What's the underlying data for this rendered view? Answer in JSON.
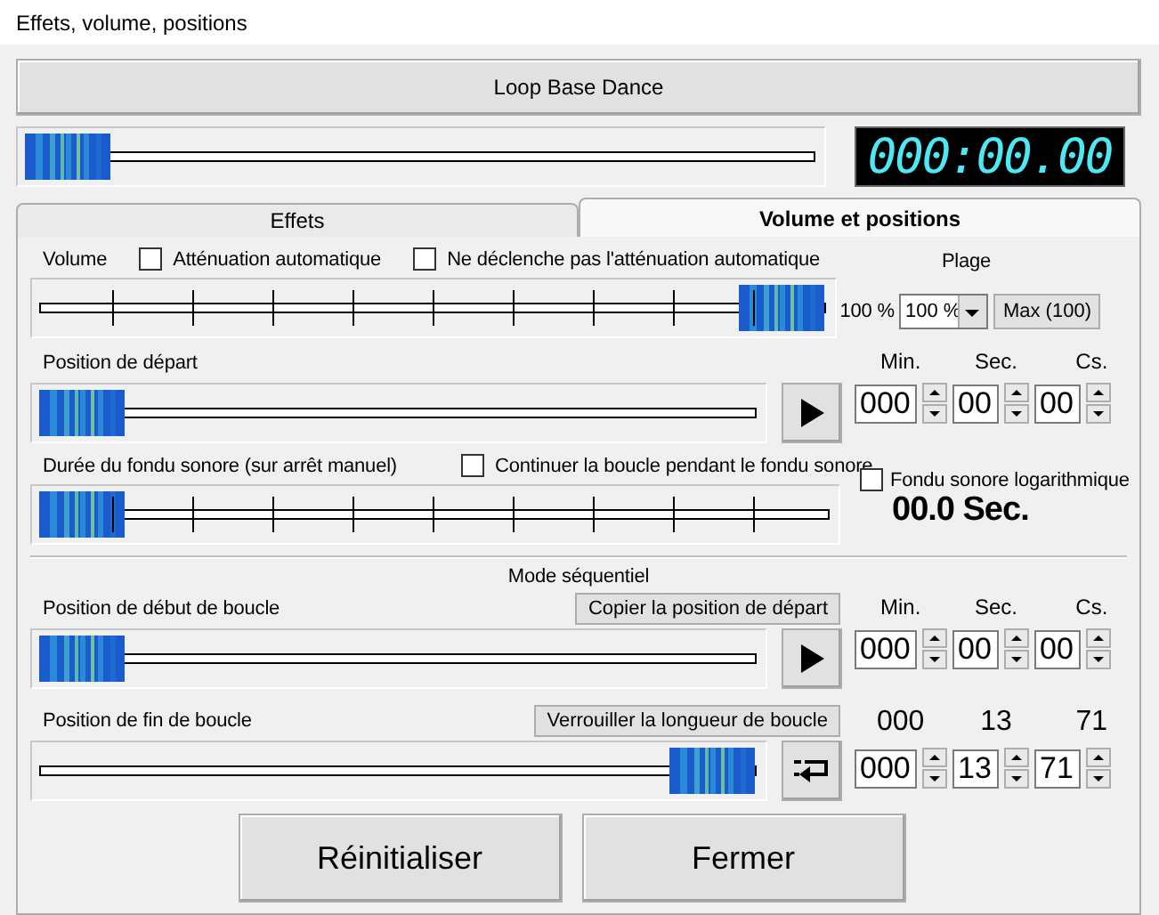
{
  "window": {
    "title": "Effets, volume, positions"
  },
  "track_button": "Loop Base Dance",
  "playback": {
    "level": 0,
    "time_display": "000:00.00"
  },
  "tabs": [
    {
      "label": "Effets",
      "selected": false
    },
    {
      "label": "Volume et positions",
      "selected": true
    }
  ],
  "volume": {
    "label": "Volume",
    "checkboxes": [
      {
        "label": "Atténuation automatique",
        "checked": false
      },
      {
        "label": "Ne déclenche pas l'atténuation automatique",
        "checked": false
      }
    ],
    "level": 1,
    "reading": "100 %",
    "range": {
      "label": "Plage",
      "value": "100 %"
    },
    "max_button": "Max (100)"
  },
  "start_position": {
    "label": "Position de départ",
    "level": 0,
    "headers": [
      "Min.",
      "Sec.",
      "Cs."
    ],
    "fields": [
      "000",
      "00",
      "00"
    ]
  },
  "fade": {
    "label": "Durée du fondu sonore (sur arrêt manuel)",
    "checkbox": {
      "label": "Continuer la boucle pendant le fondu sonore",
      "checked": false
    },
    "level": 0,
    "log_checkbox": {
      "label": "Fondu sonore logarithmique",
      "checked": false
    },
    "duration": "00.0 Sec."
  },
  "sequential_mode": {
    "title": "Mode séquentiel",
    "loop_start": {
      "label": "Position de début de boucle",
      "button": "Copier la position de départ",
      "level": 0,
      "headers": [
        "Min.",
        "Sec.",
        "Cs."
      ],
      "fields": [
        "000",
        "00",
        "00"
      ]
    },
    "loop_end": {
      "label": "Position de fin de boucle",
      "button": "Verrouiller la longueur de boucle",
      "level": 1,
      "readout": [
        "000",
        "13",
        "71"
      ],
      "fields": [
        "000",
        "13",
        "71"
      ]
    }
  },
  "buttons": [
    "Réinitialiser",
    "Fermer"
  ]
}
